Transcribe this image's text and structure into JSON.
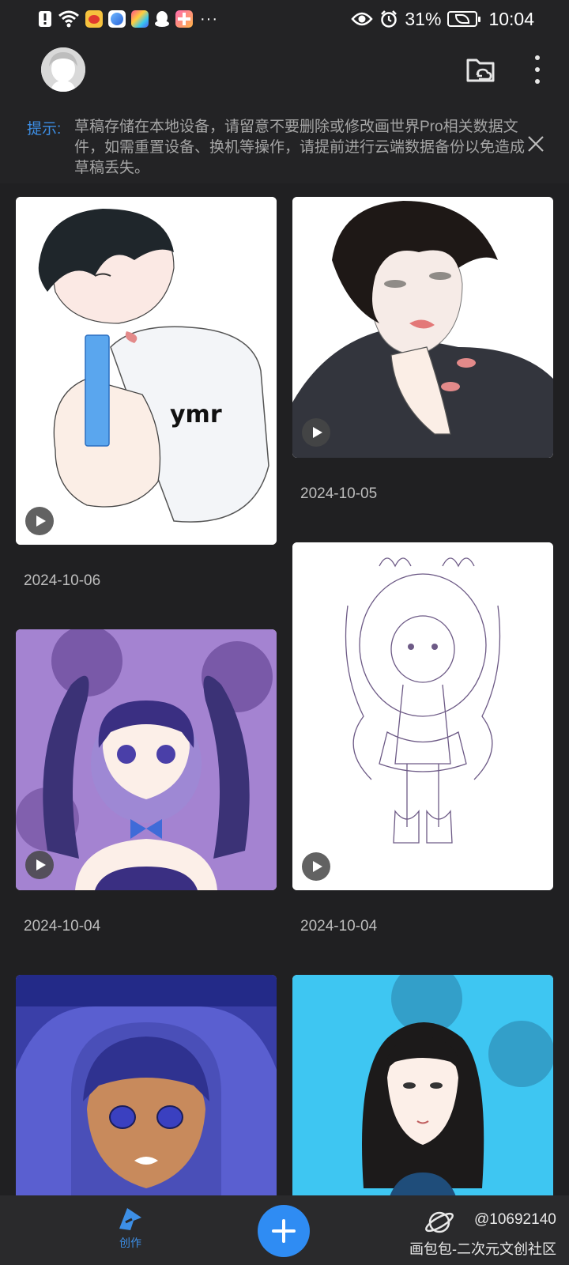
{
  "status_bar": {
    "battery_percent": "31%",
    "time": "10:04"
  },
  "notice": {
    "label": "提示:",
    "text": "草稿存储在本地设备，请留意不要删除或修改画世界Pro相关数据文件，如需重置设备、换机等操作，请提前进行云端数据备份以免造成草稿丢失。"
  },
  "drafts": [
    {
      "date": "2024-10-06",
      "has_video": true
    },
    {
      "date": "2024-10-05",
      "has_video": true
    },
    {
      "date": "2024-10-04",
      "has_video": true
    },
    {
      "date": "2024-10-04",
      "has_video": true
    },
    {
      "date": "",
      "has_video": false
    },
    {
      "date": "",
      "has_video": false
    }
  ],
  "bottom_nav": {
    "create_label": "创作",
    "watermark_id": "@10692140",
    "watermark_text": "画包包-二次元文创社区"
  },
  "colors": {
    "accent": "#2f8cf3",
    "notice_label": "#3d8fe6",
    "background": "#202022"
  },
  "icons": [
    "alert-icon",
    "wifi-icon",
    "weibo-icon",
    "browser-icon",
    "colorful-app-icon",
    "qq-icon",
    "painter-app-icon",
    "eye-icon",
    "alarm-icon",
    "battery-icon",
    "avatar",
    "cloud-folder-icon",
    "more-icon",
    "close-icon",
    "play-icon",
    "create-icon",
    "add-icon",
    "planet-icon"
  ]
}
